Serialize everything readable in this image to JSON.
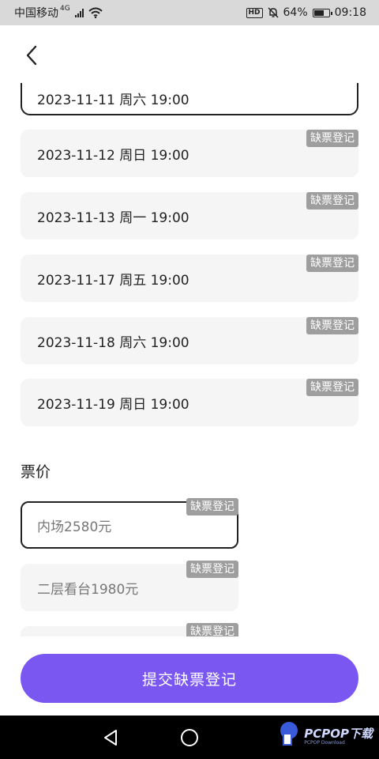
{
  "status_bar": {
    "carrier": "中国移动",
    "network": "4G",
    "hd": "HD",
    "battery": "64%",
    "time": "09:18"
  },
  "dates": [
    {
      "label": "2023-11-11 周六 19:00",
      "selected": true,
      "tag": ""
    },
    {
      "label": "2023-11-12 周日 19:00",
      "selected": false,
      "tag": "缺票登记"
    },
    {
      "label": "2023-11-13 周一 19:00",
      "selected": false,
      "tag": "缺票登记"
    },
    {
      "label": "2023-11-17 周五 19:00",
      "selected": false,
      "tag": "缺票登记"
    },
    {
      "label": "2023-11-18 周六 19:00",
      "selected": false,
      "tag": "缺票登记"
    },
    {
      "label": "2023-11-19 周日 19:00",
      "selected": false,
      "tag": "缺票登记"
    }
  ],
  "price_section_title": "票价",
  "prices": [
    {
      "label": "内场2580元",
      "selected": true,
      "tag": "缺票登记"
    },
    {
      "label": "二层看台1980元",
      "selected": false,
      "tag": "缺票登记"
    },
    {
      "label": "",
      "selected": false,
      "tag": "缺票登记"
    }
  ],
  "submit_label": "提交缺票登记",
  "watermark": {
    "brand": "PCPOP下载",
    "sub": "PCPOP Download"
  }
}
